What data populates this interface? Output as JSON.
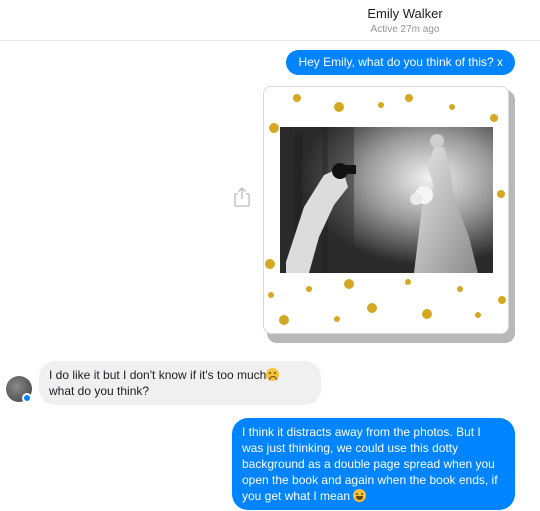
{
  "header": {
    "contact_name": "Emily Walker",
    "status": "Active 27m ago"
  },
  "messages": [
    {
      "direction": "outgoing",
      "text": "Hey Emily, what do you think of this? x"
    },
    {
      "direction": "outgoing",
      "type": "photo",
      "description_icon": "share-icon"
    },
    {
      "direction": "incoming",
      "text_line1": "I do like it but I don't know if it's too much",
      "emoji_1": "confounded-face",
      "text_line2": "what do you think?"
    },
    {
      "direction": "outgoing",
      "text": "I think it distracts away from the photos. But I was just thinking, we could use this dotty background as a double page spread when you open the book and again when the book ends, if you get what I mean",
      "emoji": "laughing-face"
    }
  ],
  "colors": {
    "outgoing_bubble": "#0084ff",
    "incoming_bubble": "#f1f0f0",
    "dot_gold": "#d4a823"
  }
}
